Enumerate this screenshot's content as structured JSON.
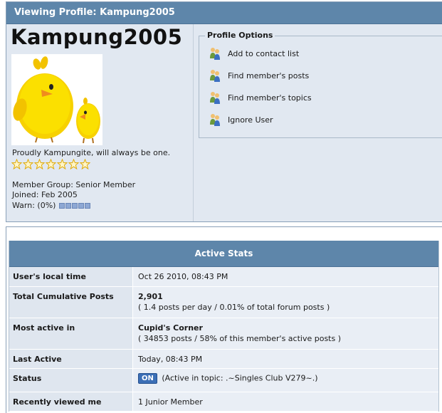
{
  "profile": {
    "header_title": "Viewing Profile: Kampung2005",
    "username": "Kampung2005",
    "tagline": "Proudly Kampungite, will always be one.",
    "star_count": 7,
    "member_group": "Member Group: Senior Member",
    "joined": "Joined: Feb 2005",
    "warn": "Warn: (0%)",
    "warn_level_percent": 0
  },
  "options": {
    "legend": "Profile Options",
    "items": [
      {
        "label": "Add to contact list",
        "icon": "users-icon"
      },
      {
        "label": "Find member's posts",
        "icon": "users-icon"
      },
      {
        "label": "Find member's topics",
        "icon": "users-icon"
      },
      {
        "label": "Ignore User",
        "icon": "users-icon"
      }
    ]
  },
  "stats": {
    "title": "Active Stats",
    "rows": [
      {
        "label": "User's local time",
        "value": "Oct 26 2010, 08:43 PM"
      },
      {
        "label": "Total Cumulative Posts",
        "value": "2,901",
        "sub": "( 1.4 posts per day / 0.01% of total forum posts )"
      },
      {
        "label": "Most active in",
        "value": "Cupid's Corner",
        "sub": "( 34853 posts / 58% of this member's active posts )"
      },
      {
        "label": "Last Active",
        "value": "Today, 08:43 PM"
      },
      {
        "label": "Status",
        "badge": "ON",
        "value": "(Active in topic: .~Singles Club V279~.)"
      },
      {
        "label": "Recently viewed me",
        "value": "1 Junior Member"
      }
    ]
  },
  "colors": {
    "header_bg": "#5e86aa",
    "panel_bg": "#e1e8f1",
    "badge_bg": "#3c6fb6"
  }
}
